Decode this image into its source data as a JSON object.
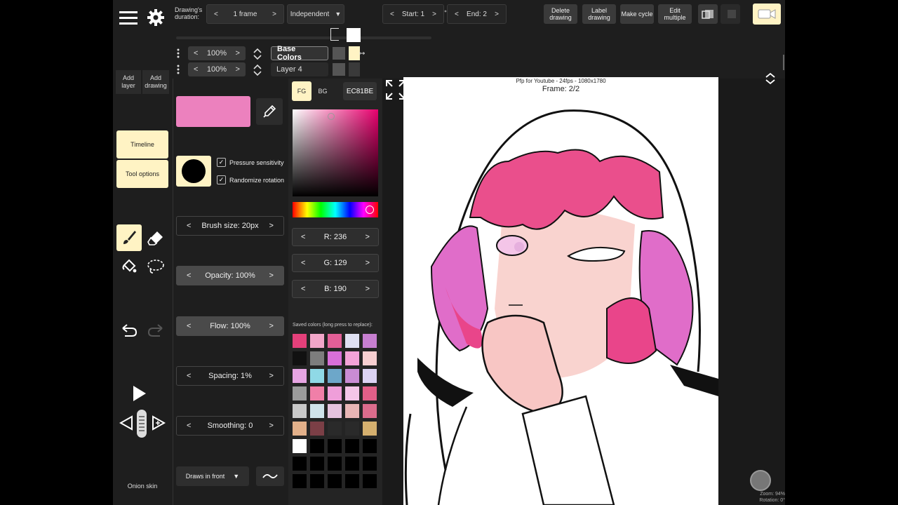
{
  "topbar": {
    "duration_label": "Drawing's\nduration:",
    "duration_value": "1 frame",
    "mode_value": "Independent",
    "start_label": "Start: 1",
    "end_label": "End: 2",
    "buttons": [
      "Delete drawing",
      "Label drawing",
      "Make cycle",
      "Edit multiple"
    ]
  },
  "layers": [
    {
      "opacity": "100%",
      "name": "Base Colors",
      "active": true
    },
    {
      "opacity": "100%",
      "name": "Layer 4",
      "active": false
    }
  ],
  "leftbar": {
    "add_layer": "Add layer",
    "add_drawing": "Add drawing",
    "timeline": "Timeline",
    "tool_options": "Tool options",
    "onion_skin": "Onion skin"
  },
  "tool_options": {
    "pressure": "Pressure sensitivity",
    "randomize": "Randomize rotation",
    "brush_size": "Brush size:  20px",
    "opacity": "Opacity:  100%",
    "flow": "Flow:  100%",
    "spacing": "Spacing:  1%",
    "smoothing": "Smoothing:  0",
    "draw_order": "Draws in front"
  },
  "color": {
    "fg_label": "FG",
    "bg_label": "BG",
    "hex": "EC81BE",
    "current": "#ec81be",
    "r": "R:  236",
    "g": "G:  129",
    "b": "B:  190",
    "saved_label": "Saved colors (long press to replace):",
    "saved": [
      "#e4407a",
      "#f2a6c9",
      "#e35f97",
      "#dfe0f2",
      "#c77fd0",
      "#111111",
      "#7d7d7d",
      "#d86fd8",
      "#f4a3d8",
      "#f7cfd1",
      "#e7a5e3",
      "#8fd9e6",
      "#6da7c9",
      "#c98cd4",
      "#dcd3f3",
      "#9b9b9b",
      "#f07fa8",
      "#ef9ed9",
      "#f4c6e8",
      "#e25f88",
      "#c9c9c9",
      "#cfe3ea",
      "#e5c3de",
      "#e8b5b5",
      "#dc6c8c",
      "#e2b08a",
      "#7b3f46",
      "#2a2a2a",
      "#2a2a2a",
      "#d5b06f",
      "#ffffff",
      "#000000",
      "#000000",
      "#000000",
      "#000000",
      "#000000",
      "#000000",
      "#000000",
      "#000000",
      "#000000",
      "#000000",
      "#000000",
      "#000000",
      "#000000",
      "#000000"
    ]
  },
  "canvas": {
    "title": "Pfp for Youtube - 24fps - 1080x1780",
    "frame": "Frame: 2/2",
    "zoom": "Zoom: 94%",
    "rotation": "Rotation: 0°"
  }
}
